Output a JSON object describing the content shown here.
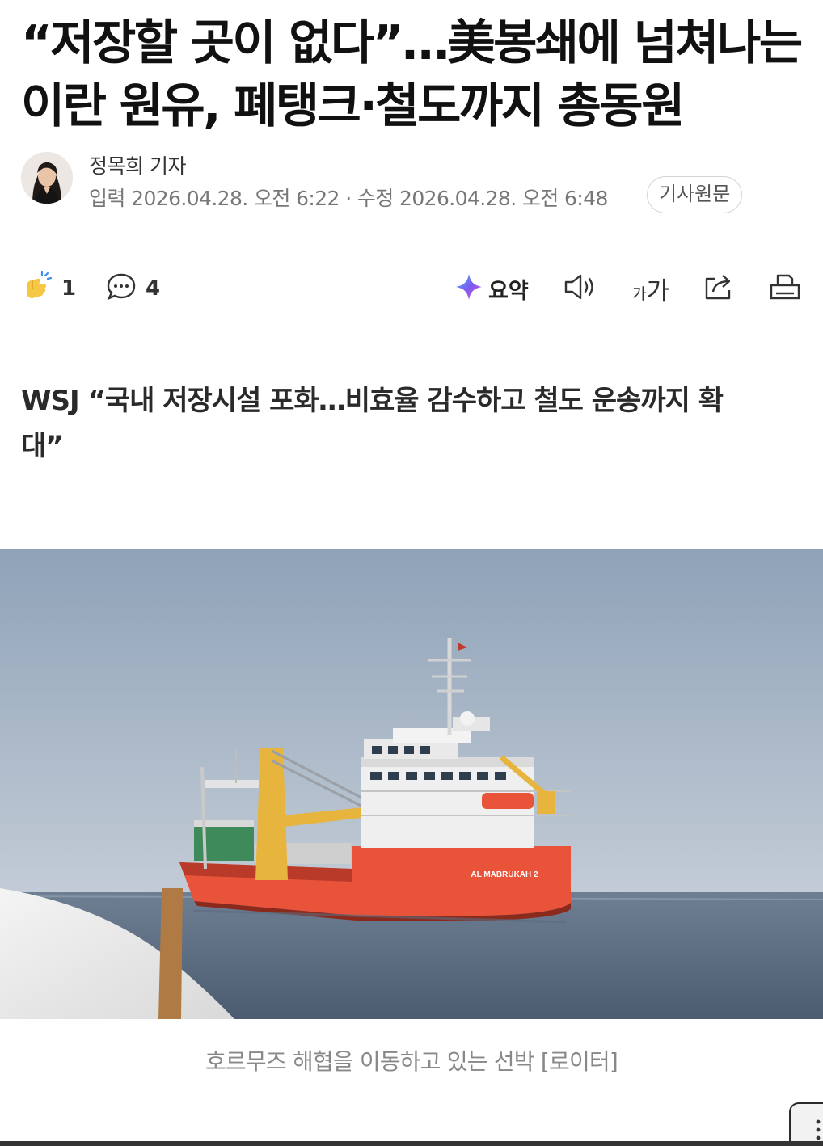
{
  "article": {
    "headline_line1": "“저장할 곳이 없다”…美봉쇄에 넘쳐나는",
    "headline_line2": "이란 원유, 폐탱크·철도까지 총동원",
    "reporter": "정목희 기자",
    "dates": "입력 2026.04.28. 오전 6:22 · 수정 2026.04.28. 오전 6:48",
    "original_button": "기사원문",
    "subheading_line1": "WSJ “국내 저장시설 포화…비효율 감수하고 철도 운송까지 확",
    "subheading_line2": "대”",
    "photo": {
      "ship_name": "AL MABRUKAH 2"
    },
    "caption": "호르무즈 해협을 이동하고 있는 선박 [로이터]"
  },
  "toolbar": {
    "like_icon": "clapping-hand-icon",
    "like_count": "1",
    "comment_icon": "speech-bubble-icon",
    "comment_count": "4",
    "summary_icon": "sparkle-icon",
    "summary_label": "요약",
    "tts_icon": "speaker-icon",
    "font_size_label_small": "가",
    "font_size_label_large": "가",
    "share_icon": "share-icon",
    "print_icon": "print-icon"
  },
  "more_icon": "vertical-dots-icon",
  "colors": {
    "hull": "#e8533a",
    "sea": "#5f6f84",
    "sky": "#aab8c9",
    "crane": "#e7b43d",
    "summary_accent": "#7b5cf0"
  }
}
